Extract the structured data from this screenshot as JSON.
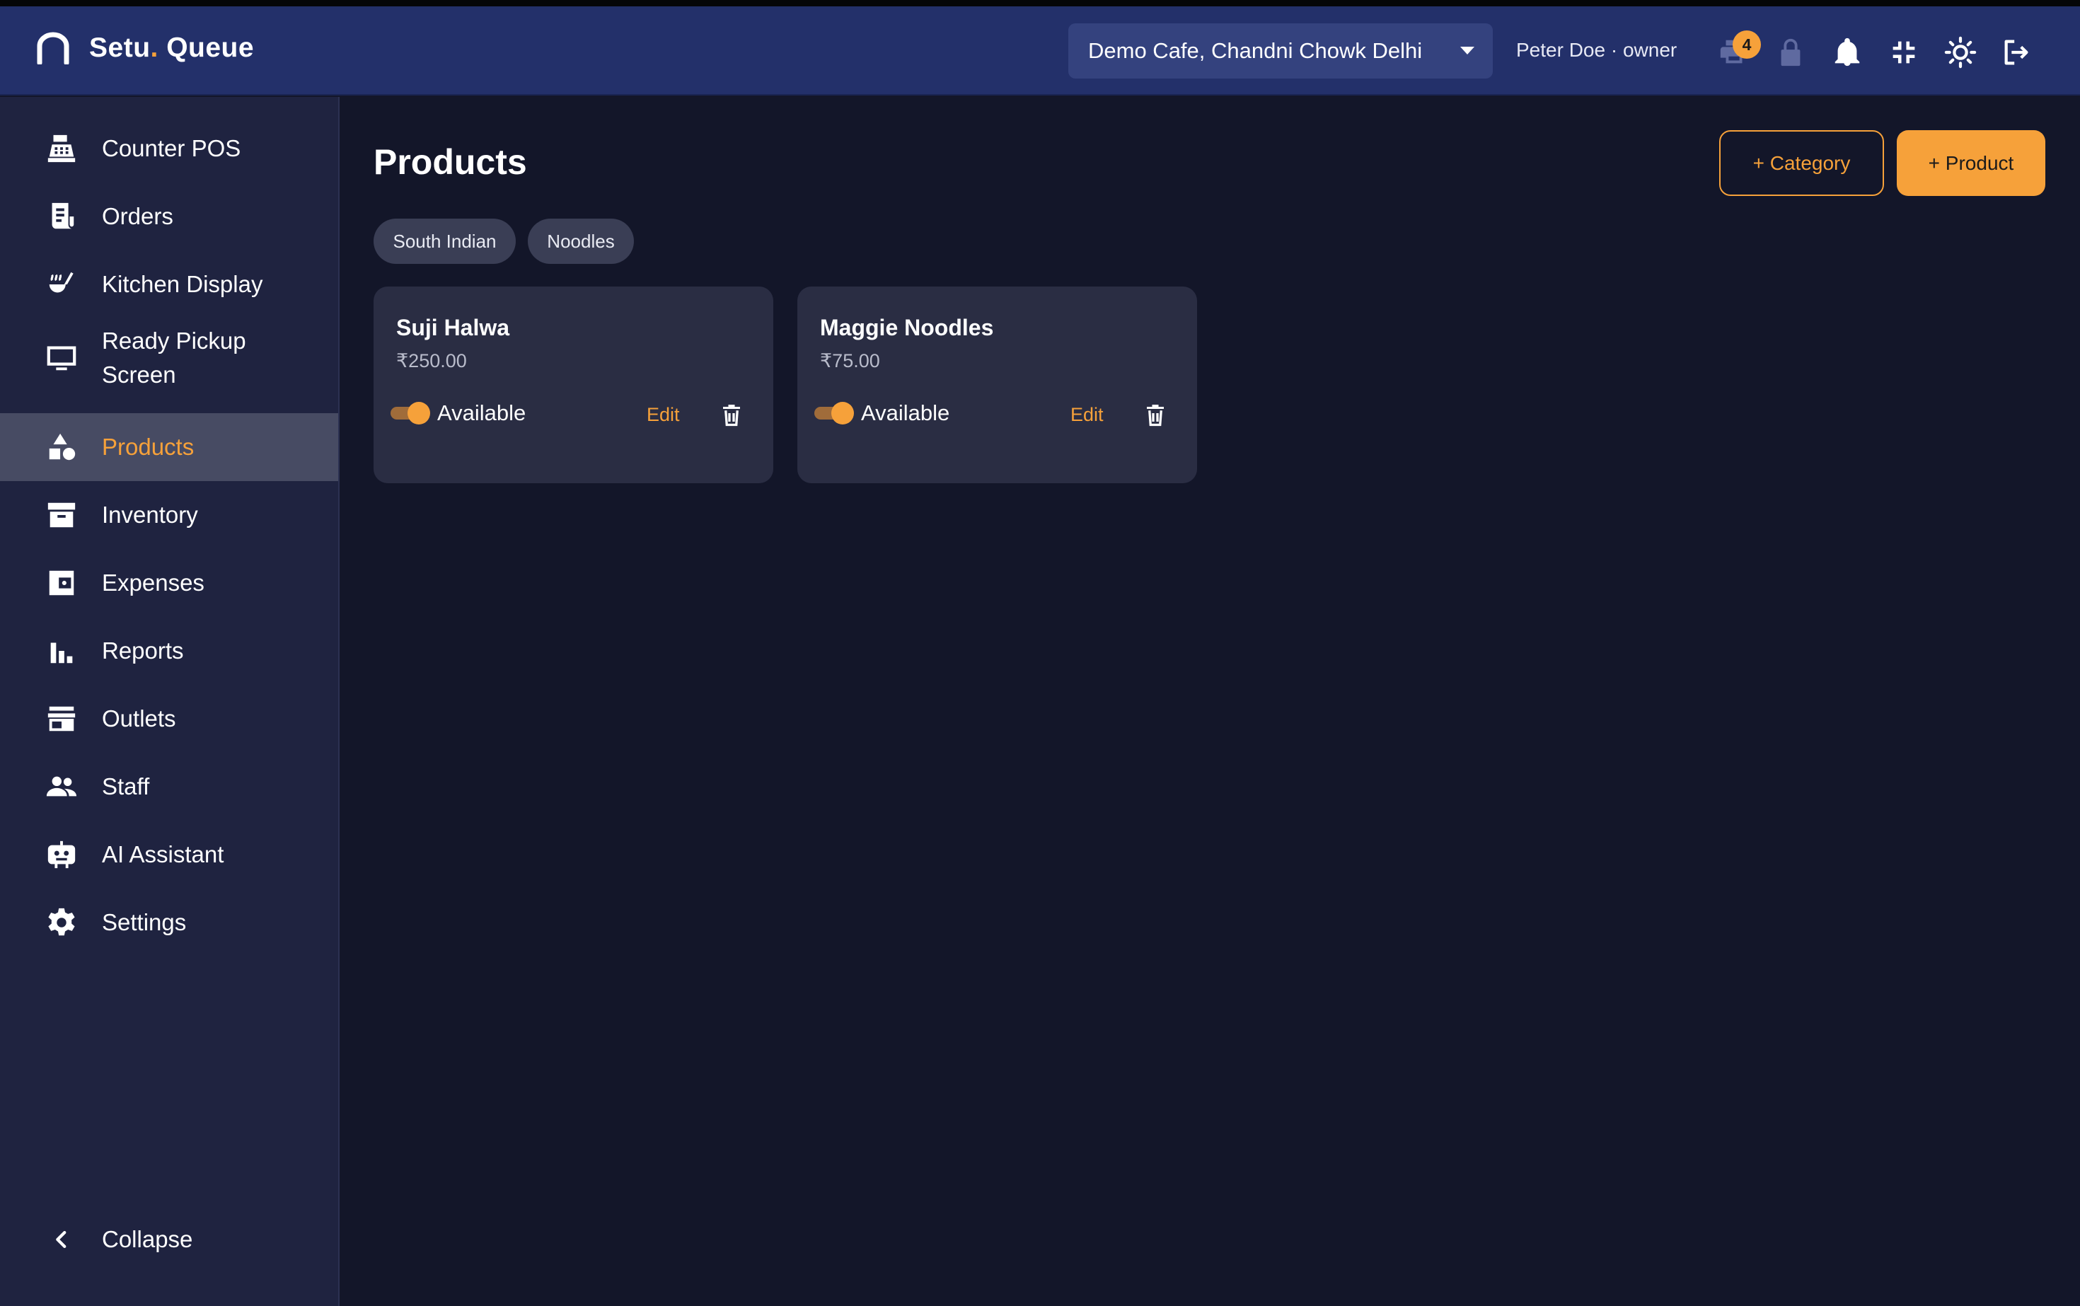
{
  "app": {
    "brand_name": "Setu",
    "brand_dot": ".",
    "brand_suffix": " Queue"
  },
  "header": {
    "outlet": "Demo Cafe, Chandni Chowk Delhi",
    "user": "Peter Doe · owner",
    "printer_badge": "4",
    "icons": [
      "printer-icon",
      "lock-icon",
      "bell-icon",
      "fullscreen-exit-icon",
      "theme-sun-icon",
      "logout-icon"
    ]
  },
  "sidebar": {
    "items": [
      {
        "label": "Counter POS",
        "icon": "cash-register-icon"
      },
      {
        "label": "Orders",
        "icon": "receipt-icon"
      },
      {
        "label": "Kitchen Display",
        "icon": "ladle-icon"
      },
      {
        "label": "Ready Pickup",
        "label2": "Screen",
        "icon": "monitor-icon"
      },
      {
        "label": "Products",
        "icon": "shapes-icon",
        "active": true
      },
      {
        "label": "Inventory",
        "icon": "archive-box-icon"
      },
      {
        "label": "Expenses",
        "icon": "wallet-icon"
      },
      {
        "label": "Reports",
        "icon": "bar-chart-icon"
      },
      {
        "label": "Outlets",
        "icon": "store-icon"
      },
      {
        "label": "Staff",
        "icon": "people-icon"
      },
      {
        "label": "AI Assistant",
        "icon": "robot-icon"
      },
      {
        "label": "Settings",
        "icon": "gear-icon"
      }
    ],
    "collapse_label": "Collapse"
  },
  "main": {
    "title": "Products",
    "add_category": "+ Category",
    "add_product": "+ Product",
    "categories": [
      "South Indian",
      "Noodles"
    ],
    "products": [
      {
        "name": "Suji Halwa",
        "price": "₹250.00",
        "status": "Available",
        "edit": "Edit"
      },
      {
        "name": "Maggie Noodles",
        "price": "₹75.00",
        "status": "Available",
        "edit": "Edit"
      }
    ]
  },
  "colors": {
    "accent": "#f6a13a",
    "topbar": "#23306a",
    "sidebar": "#1f2340",
    "background": "#131629",
    "card": "#2a2d43"
  }
}
